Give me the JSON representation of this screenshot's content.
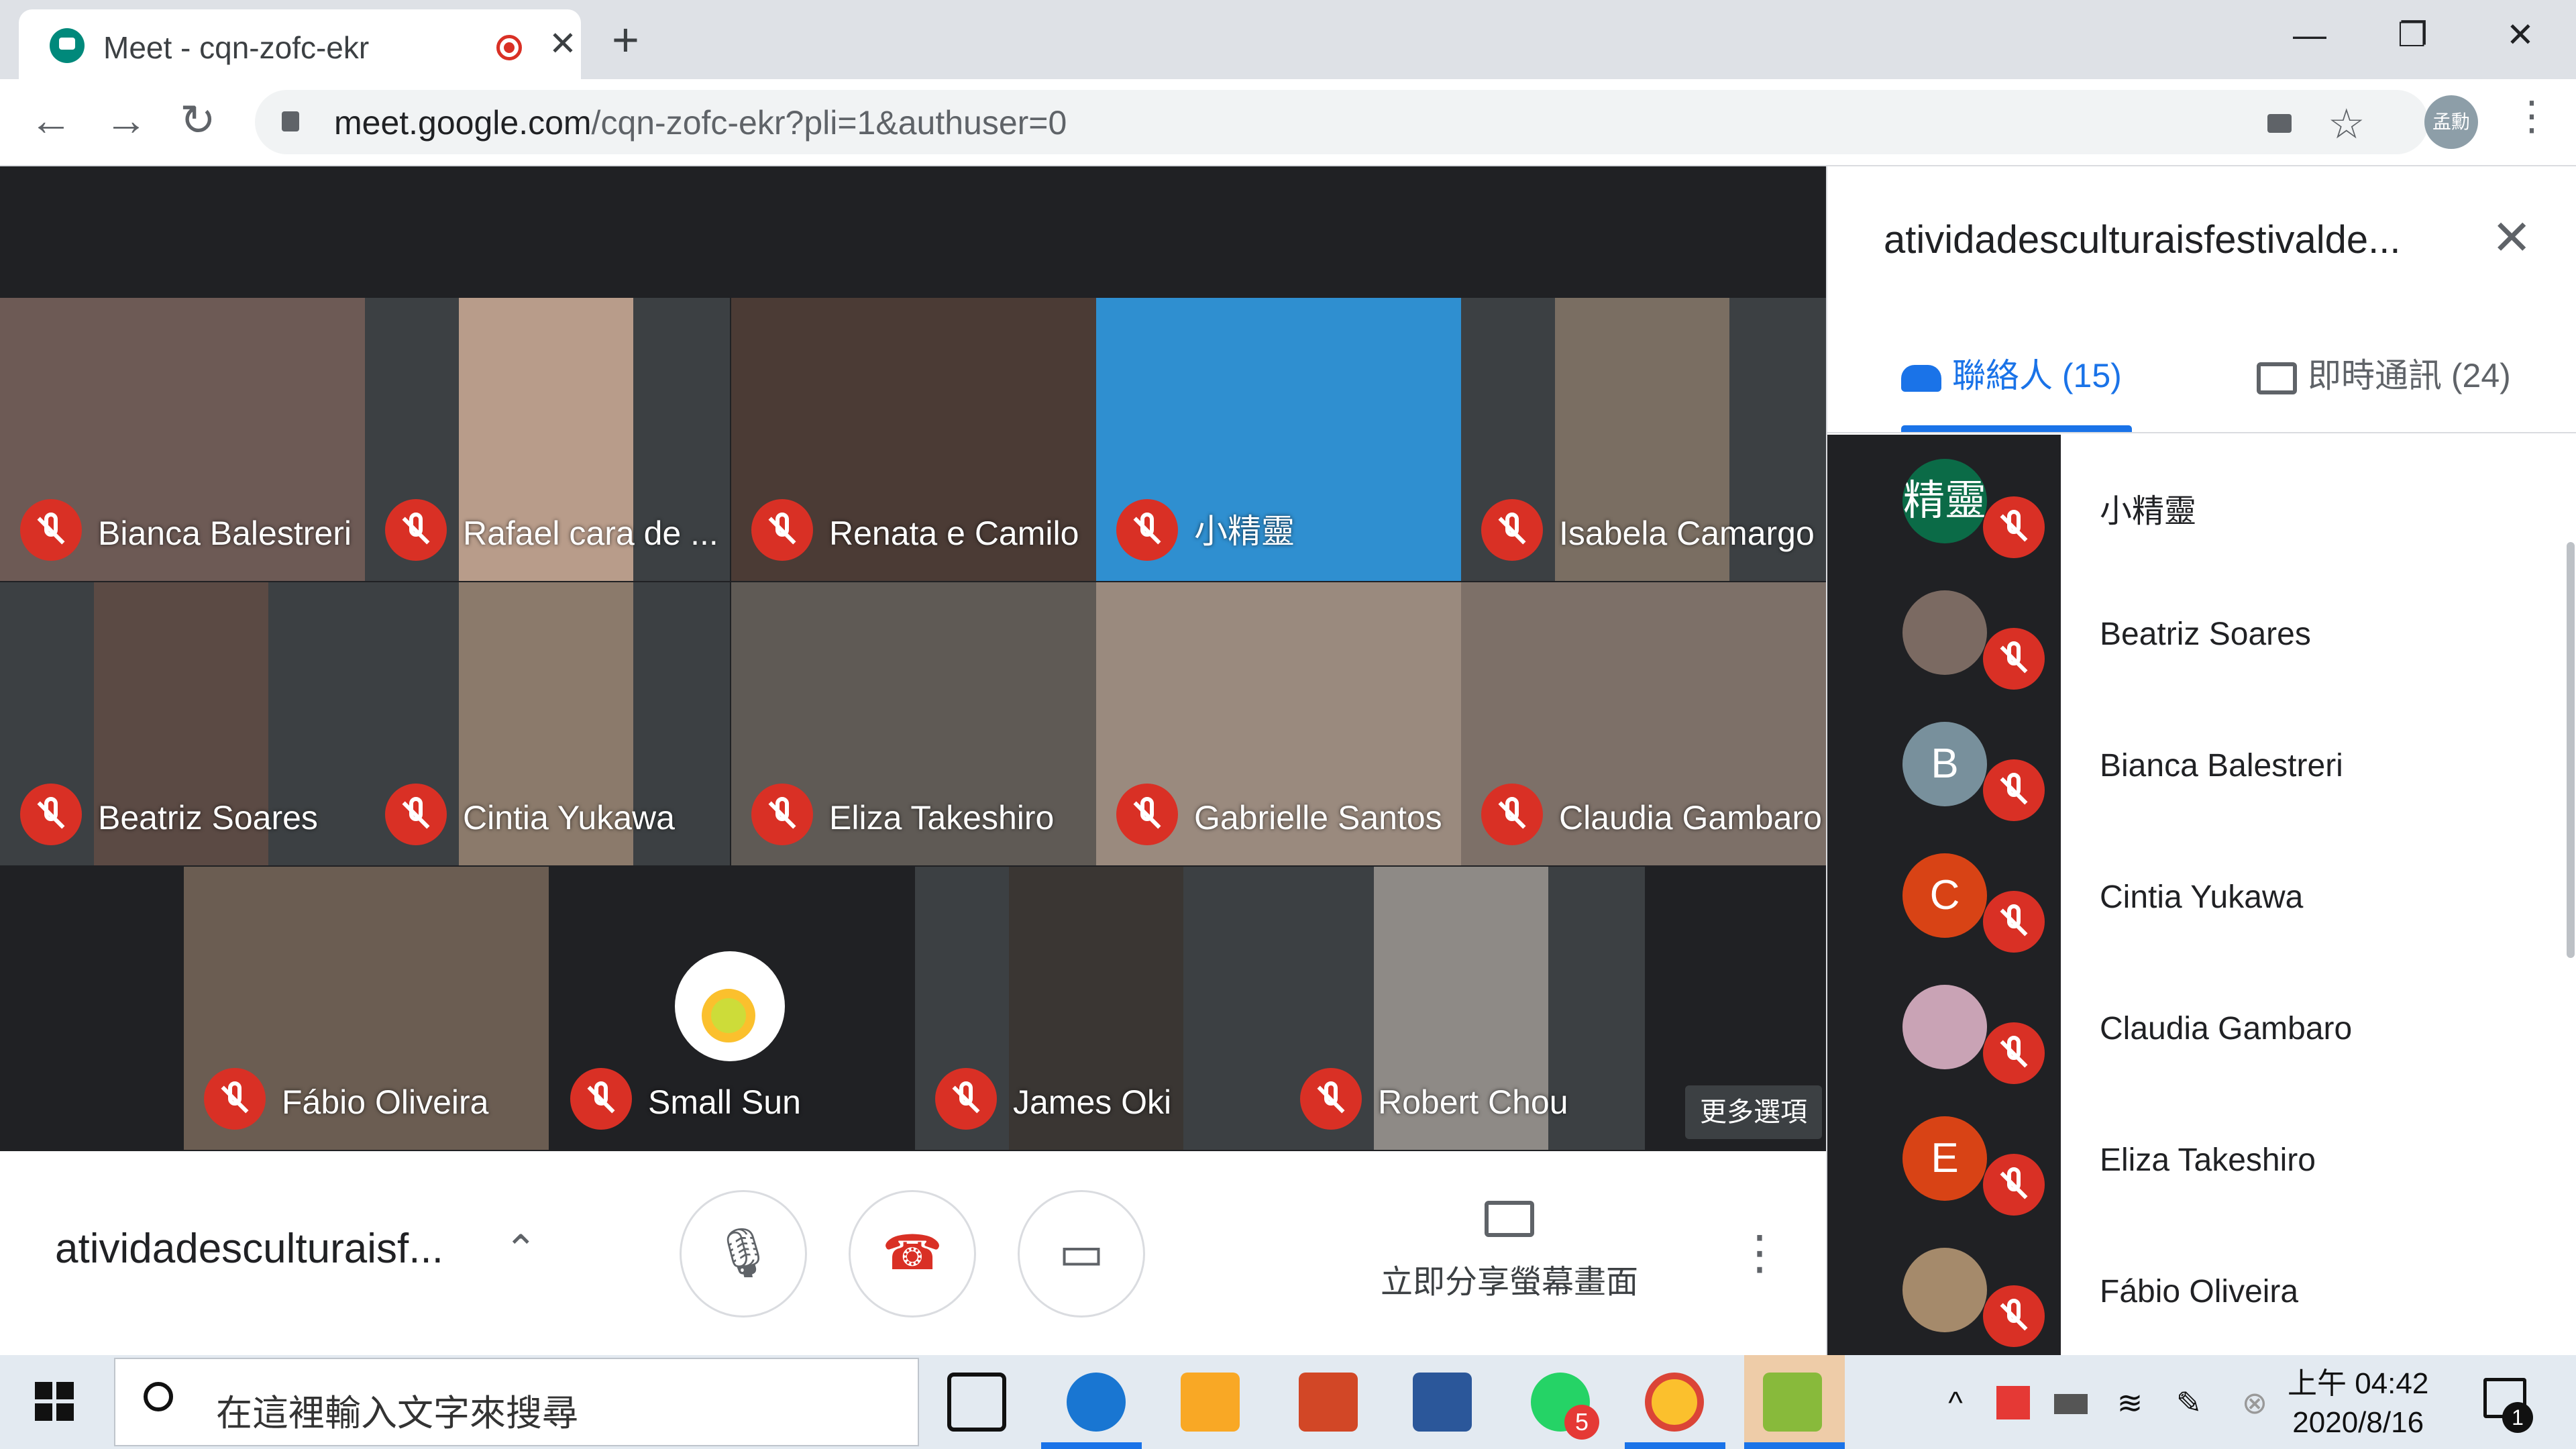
{
  "browser": {
    "tab_title": "Meet - cqn-zofc-ekr",
    "tab_close": "✕",
    "new_tab": "+",
    "window": {
      "minimize": "—",
      "restore": "❐",
      "close": "✕"
    },
    "nav": {
      "back": "←",
      "forward": "→",
      "reload": "↻"
    },
    "url_host": "meet.google.com",
    "url_path": "/cqn-zofc-ekr?pli=1&authuser=0",
    "star": "☆",
    "profile_label": "孟勳",
    "menu": "⋮"
  },
  "meet": {
    "tiles": [
      {
        "name": "Bianca Balestreri",
        "bg": "#6d5a55"
      },
      {
        "name": "Rafael cara de ...",
        "bg": "#b89c8a"
      },
      {
        "name": "Renata e Camilo",
        "bg": "#4b3b35"
      },
      {
        "name": "小精靈",
        "bg": "#2f8fd0"
      },
      {
        "name": "Isabela Camargo",
        "bg": "#7a6e62"
      },
      {
        "name": "Beatriz Soares",
        "bg": "#5b4a44"
      },
      {
        "name": "Cintia Yukawa",
        "bg": "#8b7a6b"
      },
      {
        "name": "Eliza Takeshiro",
        "bg": "#5f5a55"
      },
      {
        "name": "Gabrielle Santos",
        "bg": "#9a8a7e"
      },
      {
        "name": "Claudia Gambaro",
        "bg": "#7d7068"
      },
      {
        "name": "Fábio Oliveira",
        "bg": "#6b5d52"
      },
      {
        "name": "Small Sun",
        "bg": "#202124"
      },
      {
        "name": "James Oki",
        "bg": "#3a3633"
      },
      {
        "name": "Robert Chou",
        "bg": "#8e8a86"
      }
    ],
    "more_options": "更多選項",
    "meeting_name": "atividadesculturaisf...",
    "chevron": "⌃",
    "controls": {
      "mic": "🎙",
      "hangup": "☎",
      "camera": "▭"
    },
    "share_label": "立即分享螢幕畫面",
    "more_vert": "⋮"
  },
  "panel": {
    "title": "atividadesculturaisfestivalde...",
    "close": "✕",
    "tab_people": "聯絡人 (15)",
    "tab_chat": "即時通訊 (24)",
    "people": [
      {
        "name": "小精靈",
        "avatar": "精靈",
        "color": "#0b6b47"
      },
      {
        "name": "Beatriz Soares",
        "avatar": "",
        "color": "#7b6a62"
      },
      {
        "name": "Bianca Balestreri",
        "avatar": "B",
        "color": "#78909c"
      },
      {
        "name": "Cintia Yukawa",
        "avatar": "C",
        "color": "#d84315"
      },
      {
        "name": "Claudia Gambaro",
        "avatar": "",
        "color": "#c9a3b5"
      },
      {
        "name": "Eliza Takeshiro",
        "avatar": "E",
        "color": "#d84315"
      },
      {
        "name": "Fábio Oliveira",
        "avatar": "",
        "color": "#a58a6b"
      }
    ]
  },
  "taskbar": {
    "search_placeholder": "在這裡輸入文字來搜尋",
    "time": "上午 04:42",
    "date": "2020/8/16",
    "notif_count": "1",
    "whatsapp_badge": "5"
  }
}
